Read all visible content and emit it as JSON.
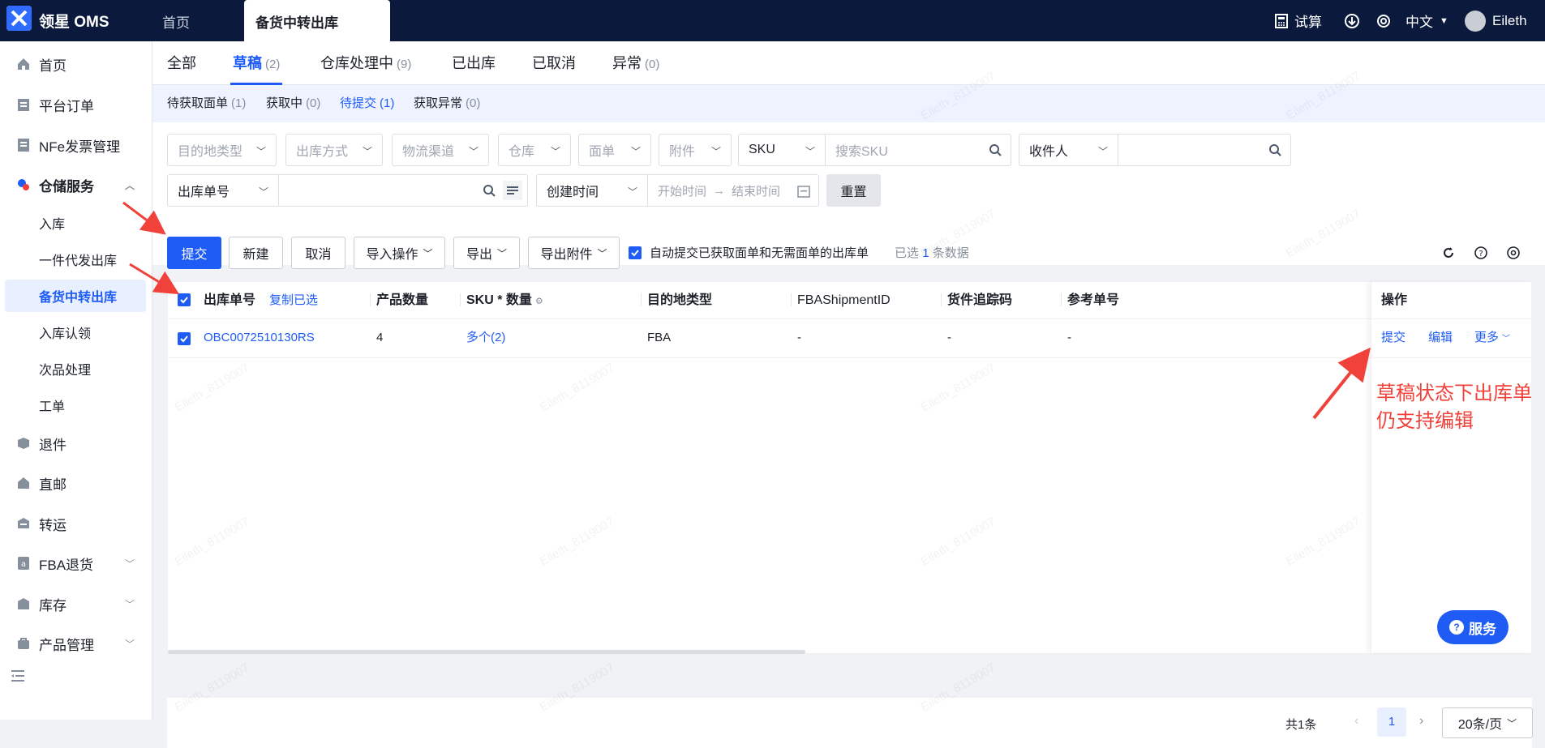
{
  "app": {
    "title": "领星 OMS"
  },
  "top_tabs": [
    {
      "label": "首页"
    },
    {
      "label": "备货中转出库"
    }
  ],
  "top_right": {
    "calc": "试算",
    "lang": "中文",
    "user": "Eileth"
  },
  "sidebar": {
    "items": [
      {
        "label": "首页"
      },
      {
        "label": "平台订单"
      },
      {
        "label": "NFe发票管理"
      },
      {
        "label": "仓储服务"
      },
      {
        "label": "退件"
      },
      {
        "label": "直邮"
      },
      {
        "label": "转运"
      },
      {
        "label": "FBA退货"
      },
      {
        "label": "库存"
      },
      {
        "label": "产品管理"
      }
    ],
    "sub_items": [
      {
        "label": "入库"
      },
      {
        "label": "一件代发出库"
      },
      {
        "label": "备货中转出库"
      },
      {
        "label": "入库认领"
      },
      {
        "label": "次品处理"
      },
      {
        "label": "工单"
      }
    ]
  },
  "status_tabs": [
    {
      "label": "全部",
      "count": ""
    },
    {
      "label": "草稿",
      "count": "(2)"
    },
    {
      "label": "仓库处理中",
      "count": "(9)"
    },
    {
      "label": "已出库",
      "count": ""
    },
    {
      "label": "已取消",
      "count": ""
    },
    {
      "label": "异常",
      "count": "(0)"
    }
  ],
  "sub_tabs": [
    {
      "label": "待获取面单",
      "count": "(1)"
    },
    {
      "label": "获取中",
      "count": "(0)"
    },
    {
      "label": "待提交",
      "count": "(1)"
    },
    {
      "label": "获取异常",
      "count": "(0)"
    }
  ],
  "filters": {
    "dest_type": "目的地类型",
    "out_method": "出库方式",
    "logistics": "物流渠道",
    "warehouse": "仓库",
    "label": "面单",
    "attachment": "附件",
    "sku_type": "SKU",
    "sku_placeholder": "搜索SKU",
    "receiver_type": "收件人",
    "order_no_type": "出库单号",
    "time_type": "创建时间",
    "start_time": "开始时间",
    "arrow": "→",
    "end_time": "结束时间",
    "reset": "重置"
  },
  "actions": {
    "submit": "提交",
    "new": "新建",
    "cancel": "取消",
    "import": "导入操作",
    "export": "导出",
    "export_attach": "导出附件",
    "auto_submit": "自动提交已获取面单和无需面单的出库单",
    "selected_prefix": "已选",
    "selected_count": "1",
    "selected_suffix": "条数据"
  },
  "table": {
    "columns": {
      "order_no": "出库单号",
      "copy_selected": "复制已选",
      "qty": "产品数量",
      "sku_qty": "SKU * 数量",
      "dest_type": "目的地类型",
      "fba_id": "FBAShipmentID",
      "tracking": "货件追踪码",
      "ref": "参考单号",
      "ops": "操作"
    },
    "rows": [
      {
        "order_no": "OBC0072510130RS",
        "qty": "4",
        "sku_qty": "多个(2)",
        "dest_type": "FBA",
        "fba_id": "-",
        "tracking": "-",
        "ref": "-",
        "op_submit": "提交",
        "op_edit": "编辑",
        "op_more": "更多"
      }
    ]
  },
  "annotation": {
    "line1": "草稿状态下出库单",
    "line2": "仍支持编辑"
  },
  "pager": {
    "total": "共1条",
    "page": "1",
    "page_size": "20条/页"
  },
  "service": {
    "label": "服务"
  },
  "watermark": "Eileth_8119007",
  "colors": {
    "primary": "#1f5cf5",
    "topbar": "#0b1a3c",
    "annotation": "#f0413a"
  }
}
